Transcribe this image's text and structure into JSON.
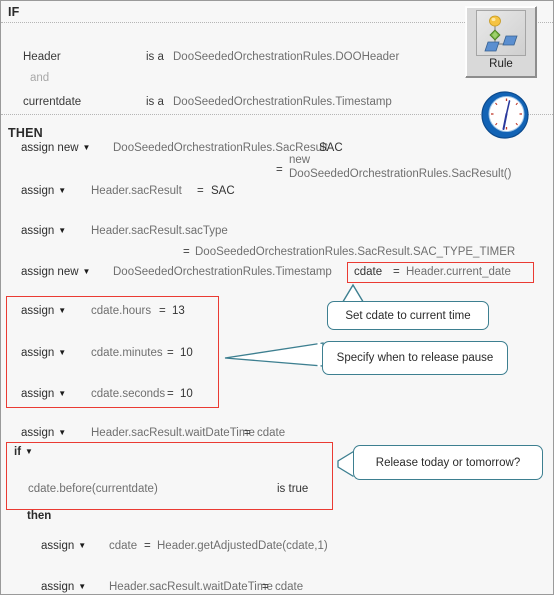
{
  "palette": {
    "rule_button_label": "Rule",
    "rule_icon": "rule-tree-icon",
    "clock_icon": "clock-icon"
  },
  "colors": {
    "highlight_red": "#ea3b33",
    "callout_teal": "#3d7f90",
    "background": "#f7f7f7",
    "text_dark": "#2e2e2e",
    "text_gray": "#7b7b7b",
    "text_faint": "#a8a8a8"
  },
  "sections": {
    "if_label": "IF",
    "then_label": "THEN"
  },
  "if_conditions": [
    {
      "variable": "Header",
      "relation": "is a",
      "type": "DooSeededOrchestrationRules.DOOHeader"
    },
    {
      "conjunction": "and"
    },
    {
      "variable": "currentdate",
      "relation": "is a",
      "type": "DooSeededOrchestrationRules.Timestamp"
    }
  ],
  "then_actions": [
    {
      "op": "assign new",
      "type": "DooSeededOrchestrationRules.SacResult",
      "var": "SAC",
      "eq": "=",
      "value_line1": "new",
      "value_line2": "DooSeededOrchestrationRules.SacResult()"
    },
    {
      "op": "assign",
      "target": "Header.sacResult",
      "eq": "=",
      "value": "SAC"
    },
    {
      "op": "assign",
      "target": "Header.sacResult.sacType",
      "eq": "=",
      "value": "DooSeededOrchestrationRules.SacResult.SAC_TYPE_TIMER"
    },
    {
      "op": "assign new",
      "type": "DooSeededOrchestrationRules.Timestamp",
      "var": "cdate",
      "eq": "=",
      "value": "Header.current_date"
    },
    {
      "op": "assign",
      "target": "cdate.hours",
      "eq": "=",
      "value": "13"
    },
    {
      "op": "assign",
      "target": "cdate.minutes",
      "eq": "=",
      "value": "10"
    },
    {
      "op": "assign",
      "target": "cdate.seconds",
      "eq": "=",
      "value": "10"
    },
    {
      "op": "assign",
      "target": "Header.sacResult.waitDateTime",
      "eq": "=",
      "value": "cdate"
    }
  ],
  "nested_if": {
    "op": "if",
    "test": "cdate.before(currentdate)",
    "test_result": "is true",
    "then_label": "then",
    "actions": [
      {
        "op": "assign",
        "target": "cdate",
        "eq": "=",
        "value": "Header.getAdjustedDate(cdate,1)"
      },
      {
        "op": "assign",
        "target": "Header.sacResult.waitDateTime",
        "eq": "=",
        "value": "cdate"
      }
    ]
  },
  "callouts": [
    {
      "text": "Set cdate to current time"
    },
    {
      "text": "Specify when to release pause"
    },
    {
      "text": "Release today or tomorrow?"
    }
  ]
}
